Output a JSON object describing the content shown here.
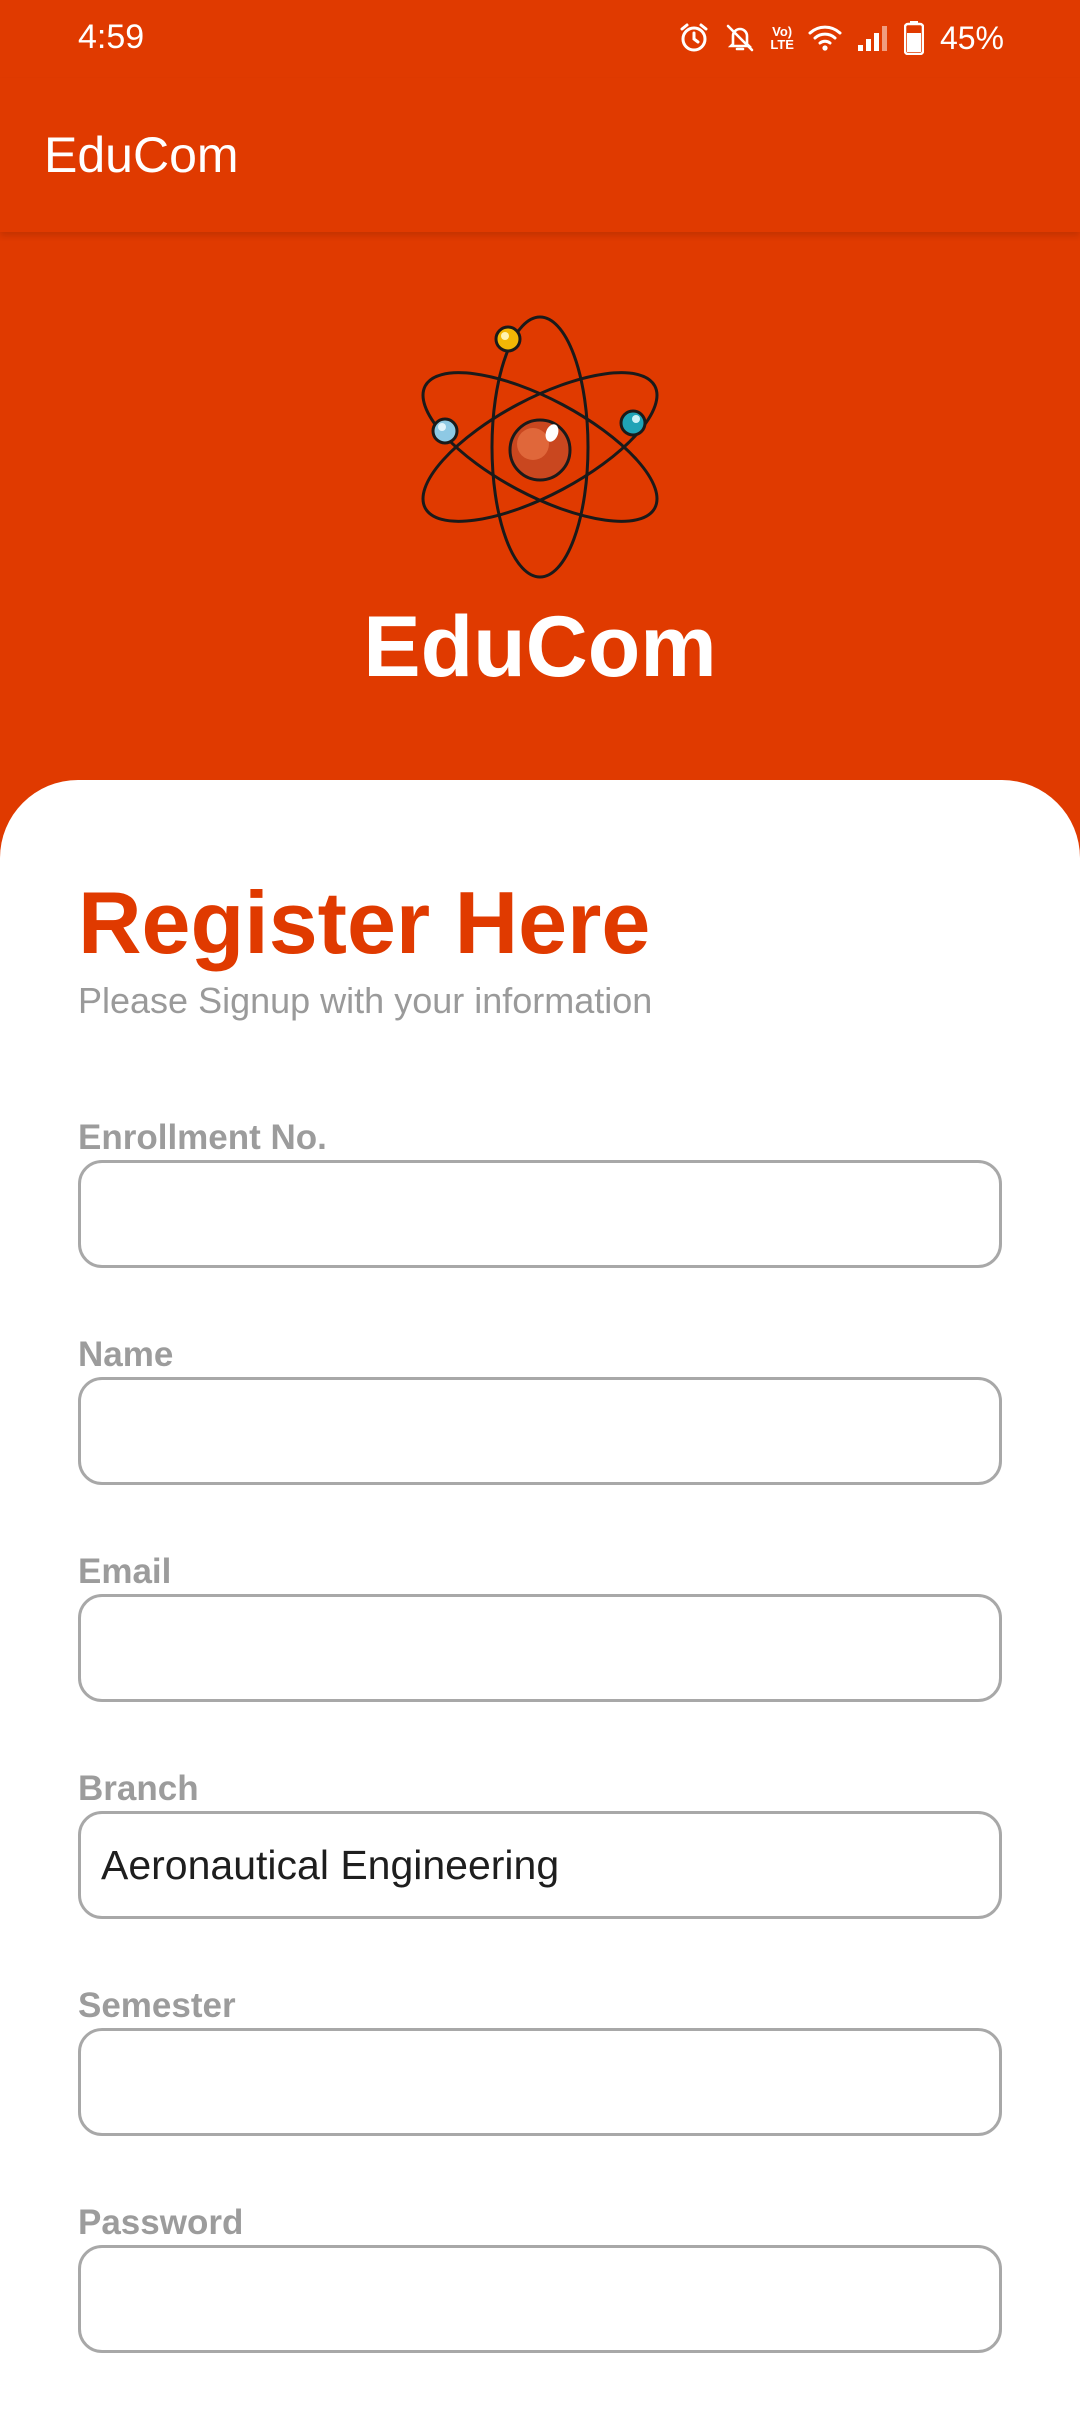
{
  "status_bar": {
    "time": "4:59",
    "battery_percent": "45%",
    "volte_top": "Vo)",
    "volte_bottom": "LTE",
    "icons": [
      "alarm-icon",
      "notifications-off-icon",
      "volte-icon",
      "wifi-icon",
      "signal-icon",
      "battery-icon"
    ]
  },
  "app_bar": {
    "title": "EduCom"
  },
  "hero": {
    "logo_icon": "atom-icon",
    "brand": "EduCom"
  },
  "form": {
    "title": "Register Here",
    "subtitle": "Please Signup with your information",
    "fields": [
      {
        "label": "Enrollment No.",
        "value": ""
      },
      {
        "label": "Name",
        "value": ""
      },
      {
        "label": "Email",
        "value": ""
      },
      {
        "label": "Branch",
        "value": "Aeronautical Engineering"
      },
      {
        "label": "Semester",
        "value": ""
      },
      {
        "label": "Password",
        "value": ""
      }
    ]
  },
  "colors": {
    "primary": "#E03A00",
    "label_gray": "#9c9c9c",
    "border_gray": "#a8a8a8"
  }
}
